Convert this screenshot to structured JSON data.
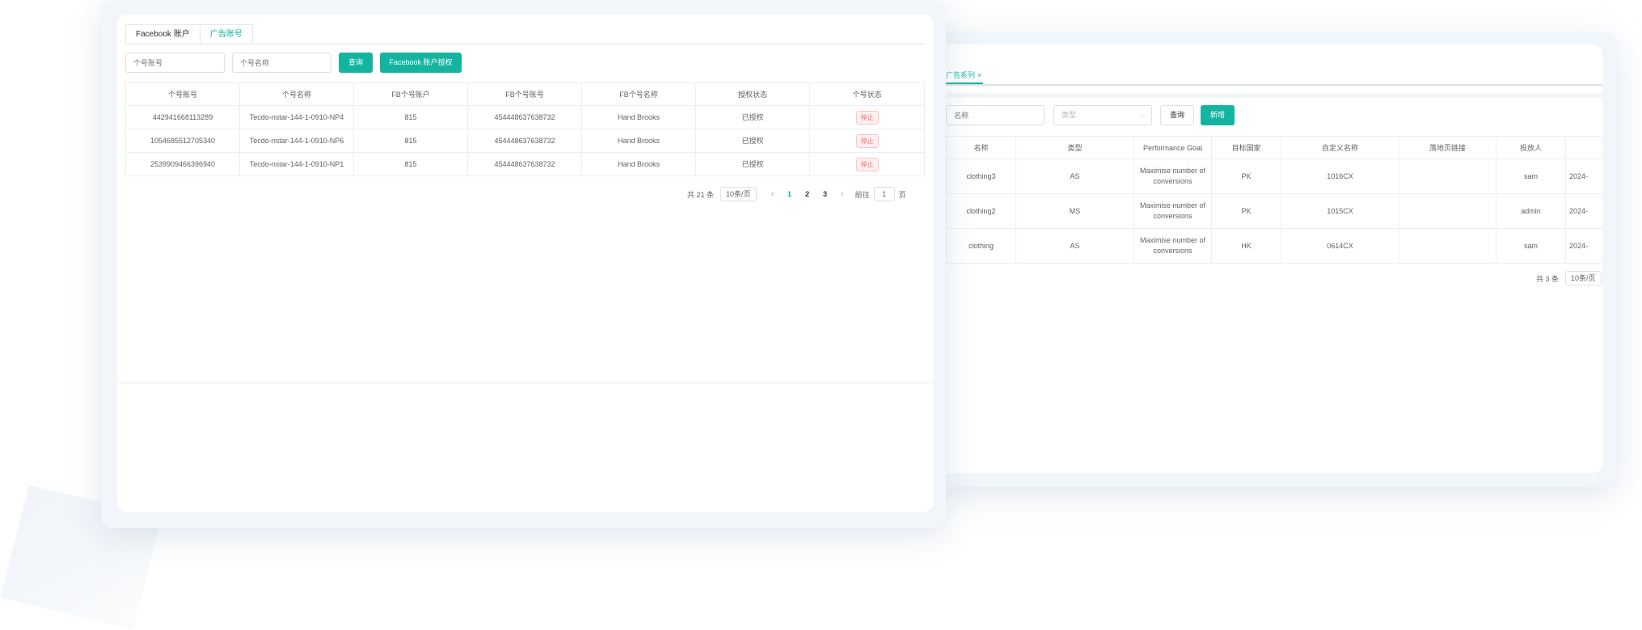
{
  "front": {
    "tabs": [
      {
        "label": "Facebook 账户"
      },
      {
        "label": "广告账号"
      }
    ],
    "filters": {
      "account_id_placeholder": "个号账号",
      "account_name_placeholder": "个号名称",
      "search_label": "查询",
      "authorize_label": "Facebook 账户授权"
    },
    "table": {
      "headers": [
        "个号账号",
        "个号名称",
        "FB个号账户",
        "FB个号账号",
        "FB个号名称",
        "授权状态",
        "个号状态"
      ],
      "rows": [
        {
          "id": "442941668113289",
          "name": "Tecdo-nstar-144-1-0910-NP4",
          "fb_account": "815",
          "fb_id": "454448637638732",
          "fb_name": "Hand Brooks",
          "auth": "已授权",
          "status": "停止"
        },
        {
          "id": "1054685512705340",
          "name": "Tecdo-nstar-144-1-0910-NP6",
          "fb_account": "815",
          "fb_id": "454448637638732",
          "fb_name": "Hand Brooks",
          "auth": "已授权",
          "status": "停止"
        },
        {
          "id": "2539909466396940",
          "name": "Tecdo-nstar-144-1-0910-NP1",
          "fb_account": "815",
          "fb_id": "454448637638732",
          "fb_name": "Hand Brooks",
          "auth": "已授权",
          "status": "停止"
        }
      ]
    },
    "pager": {
      "total": "共 21 条",
      "size": "10条/页",
      "pages": [
        "1",
        "2",
        "3"
      ],
      "goto_prefix": "前往",
      "goto_value": "1",
      "goto_suffix": "页"
    }
  },
  "back": {
    "tab": {
      "label": "广告系列",
      "close": "×"
    },
    "filters": {
      "name_placeholder": "名称",
      "type_placeholder": "类型",
      "search_label": "查询",
      "add_label": "新增"
    },
    "table": {
      "headers": [
        "名称",
        "类型",
        "Performance Goal",
        "目标国家",
        "自定义名称",
        "落地页链接",
        "投放人",
        ""
      ],
      "rows": [
        {
          "name": "clothing3",
          "type": "AS",
          "goal": "Maximise number of conversions",
          "country": "PK",
          "custom": "1016CX",
          "link": "",
          "owner": "sam",
          "date": "2024-"
        },
        {
          "name": "clothing2",
          "type": "MS",
          "goal": "Maximise number of conversions",
          "country": "PK",
          "custom": "1015CX",
          "link": "",
          "owner": "admin",
          "date": "2024-"
        },
        {
          "name": "clothing",
          "type": "AS",
          "goal": "Maximise number of conversions",
          "country": "HK",
          "custom": "0614CX",
          "link": "",
          "owner": "sam",
          "date": "2024-"
        }
      ]
    },
    "pager": {
      "total": "共 3 条",
      "size": "10条/页"
    }
  },
  "colors": {
    "accent": "#13b5a0",
    "danger": "#f56c6c"
  },
  "icons": {
    "prev": "chevron-left-icon",
    "next": "chevron-right-icon",
    "dropdown": "chevron-down-icon",
    "close": "close-icon"
  }
}
